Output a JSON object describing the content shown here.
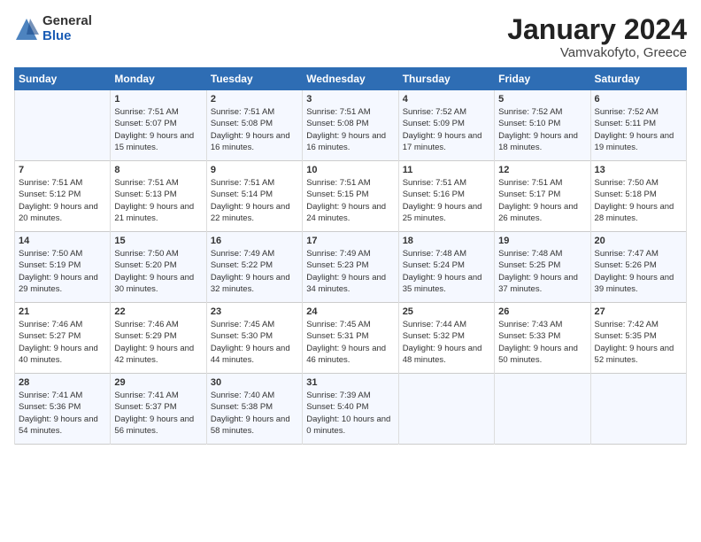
{
  "logo": {
    "general": "General",
    "blue": "Blue"
  },
  "title": "January 2024",
  "location": "Vamvakofyto, Greece",
  "weekdays": [
    "Sunday",
    "Monday",
    "Tuesday",
    "Wednesday",
    "Thursday",
    "Friday",
    "Saturday"
  ],
  "weeks": [
    [
      {
        "day": "",
        "sunrise": "",
        "sunset": "",
        "daylight": ""
      },
      {
        "day": "1",
        "sunrise": "Sunrise: 7:51 AM",
        "sunset": "Sunset: 5:07 PM",
        "daylight": "Daylight: 9 hours and 15 minutes."
      },
      {
        "day": "2",
        "sunrise": "Sunrise: 7:51 AM",
        "sunset": "Sunset: 5:08 PM",
        "daylight": "Daylight: 9 hours and 16 minutes."
      },
      {
        "day": "3",
        "sunrise": "Sunrise: 7:51 AM",
        "sunset": "Sunset: 5:08 PM",
        "daylight": "Daylight: 9 hours and 16 minutes."
      },
      {
        "day": "4",
        "sunrise": "Sunrise: 7:52 AM",
        "sunset": "Sunset: 5:09 PM",
        "daylight": "Daylight: 9 hours and 17 minutes."
      },
      {
        "day": "5",
        "sunrise": "Sunrise: 7:52 AM",
        "sunset": "Sunset: 5:10 PM",
        "daylight": "Daylight: 9 hours and 18 minutes."
      },
      {
        "day": "6",
        "sunrise": "Sunrise: 7:52 AM",
        "sunset": "Sunset: 5:11 PM",
        "daylight": "Daylight: 9 hours and 19 minutes."
      }
    ],
    [
      {
        "day": "7",
        "sunrise": "Sunrise: 7:51 AM",
        "sunset": "Sunset: 5:12 PM",
        "daylight": "Daylight: 9 hours and 20 minutes."
      },
      {
        "day": "8",
        "sunrise": "Sunrise: 7:51 AM",
        "sunset": "Sunset: 5:13 PM",
        "daylight": "Daylight: 9 hours and 21 minutes."
      },
      {
        "day": "9",
        "sunrise": "Sunrise: 7:51 AM",
        "sunset": "Sunset: 5:14 PM",
        "daylight": "Daylight: 9 hours and 22 minutes."
      },
      {
        "day": "10",
        "sunrise": "Sunrise: 7:51 AM",
        "sunset": "Sunset: 5:15 PM",
        "daylight": "Daylight: 9 hours and 24 minutes."
      },
      {
        "day": "11",
        "sunrise": "Sunrise: 7:51 AM",
        "sunset": "Sunset: 5:16 PM",
        "daylight": "Daylight: 9 hours and 25 minutes."
      },
      {
        "day": "12",
        "sunrise": "Sunrise: 7:51 AM",
        "sunset": "Sunset: 5:17 PM",
        "daylight": "Daylight: 9 hours and 26 minutes."
      },
      {
        "day": "13",
        "sunrise": "Sunrise: 7:50 AM",
        "sunset": "Sunset: 5:18 PM",
        "daylight": "Daylight: 9 hours and 28 minutes."
      }
    ],
    [
      {
        "day": "14",
        "sunrise": "Sunrise: 7:50 AM",
        "sunset": "Sunset: 5:19 PM",
        "daylight": "Daylight: 9 hours and 29 minutes."
      },
      {
        "day": "15",
        "sunrise": "Sunrise: 7:50 AM",
        "sunset": "Sunset: 5:20 PM",
        "daylight": "Daylight: 9 hours and 30 minutes."
      },
      {
        "day": "16",
        "sunrise": "Sunrise: 7:49 AM",
        "sunset": "Sunset: 5:22 PM",
        "daylight": "Daylight: 9 hours and 32 minutes."
      },
      {
        "day": "17",
        "sunrise": "Sunrise: 7:49 AM",
        "sunset": "Sunset: 5:23 PM",
        "daylight": "Daylight: 9 hours and 34 minutes."
      },
      {
        "day": "18",
        "sunrise": "Sunrise: 7:48 AM",
        "sunset": "Sunset: 5:24 PM",
        "daylight": "Daylight: 9 hours and 35 minutes."
      },
      {
        "day": "19",
        "sunrise": "Sunrise: 7:48 AM",
        "sunset": "Sunset: 5:25 PM",
        "daylight": "Daylight: 9 hours and 37 minutes."
      },
      {
        "day": "20",
        "sunrise": "Sunrise: 7:47 AM",
        "sunset": "Sunset: 5:26 PM",
        "daylight": "Daylight: 9 hours and 39 minutes."
      }
    ],
    [
      {
        "day": "21",
        "sunrise": "Sunrise: 7:46 AM",
        "sunset": "Sunset: 5:27 PM",
        "daylight": "Daylight: 9 hours and 40 minutes."
      },
      {
        "day": "22",
        "sunrise": "Sunrise: 7:46 AM",
        "sunset": "Sunset: 5:29 PM",
        "daylight": "Daylight: 9 hours and 42 minutes."
      },
      {
        "day": "23",
        "sunrise": "Sunrise: 7:45 AM",
        "sunset": "Sunset: 5:30 PM",
        "daylight": "Daylight: 9 hours and 44 minutes."
      },
      {
        "day": "24",
        "sunrise": "Sunrise: 7:45 AM",
        "sunset": "Sunset: 5:31 PM",
        "daylight": "Daylight: 9 hours and 46 minutes."
      },
      {
        "day": "25",
        "sunrise": "Sunrise: 7:44 AM",
        "sunset": "Sunset: 5:32 PM",
        "daylight": "Daylight: 9 hours and 48 minutes."
      },
      {
        "day": "26",
        "sunrise": "Sunrise: 7:43 AM",
        "sunset": "Sunset: 5:33 PM",
        "daylight": "Daylight: 9 hours and 50 minutes."
      },
      {
        "day": "27",
        "sunrise": "Sunrise: 7:42 AM",
        "sunset": "Sunset: 5:35 PM",
        "daylight": "Daylight: 9 hours and 52 minutes."
      }
    ],
    [
      {
        "day": "28",
        "sunrise": "Sunrise: 7:41 AM",
        "sunset": "Sunset: 5:36 PM",
        "daylight": "Daylight: 9 hours and 54 minutes."
      },
      {
        "day": "29",
        "sunrise": "Sunrise: 7:41 AM",
        "sunset": "Sunset: 5:37 PM",
        "daylight": "Daylight: 9 hours and 56 minutes."
      },
      {
        "day": "30",
        "sunrise": "Sunrise: 7:40 AM",
        "sunset": "Sunset: 5:38 PM",
        "daylight": "Daylight: 9 hours and 58 minutes."
      },
      {
        "day": "31",
        "sunrise": "Sunrise: 7:39 AM",
        "sunset": "Sunset: 5:40 PM",
        "daylight": "Daylight: 10 hours and 0 minutes."
      },
      {
        "day": "",
        "sunrise": "",
        "sunset": "",
        "daylight": ""
      },
      {
        "day": "",
        "sunrise": "",
        "sunset": "",
        "daylight": ""
      },
      {
        "day": "",
        "sunrise": "",
        "sunset": "",
        "daylight": ""
      }
    ]
  ]
}
